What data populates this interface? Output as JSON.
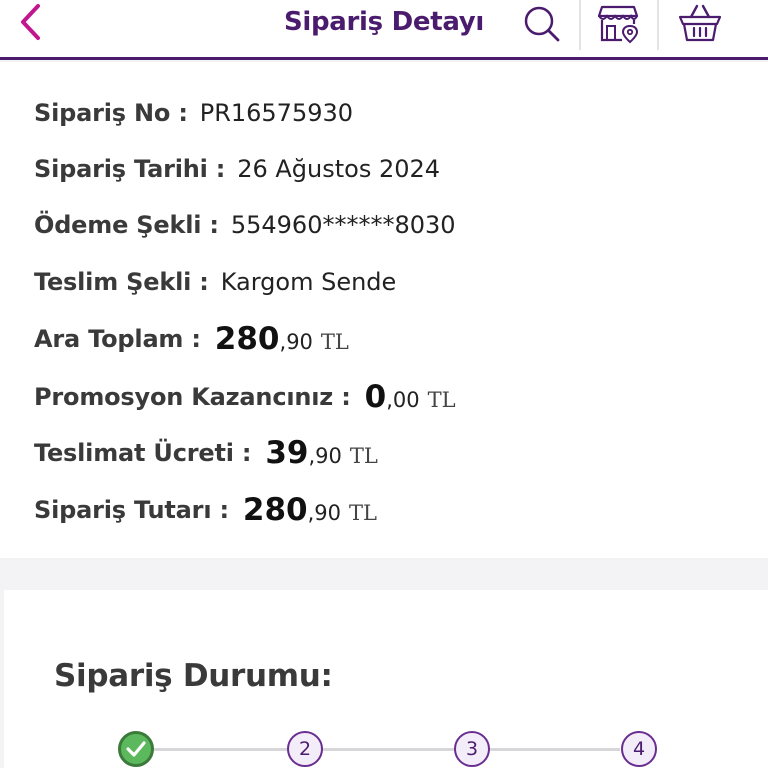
{
  "header": {
    "title": "Sipariş Detayı",
    "icons": [
      "back-chevron-icon",
      "search-icon",
      "store-location-icon",
      "basket-icon"
    ]
  },
  "order": {
    "order_no_label": "Sipariş No :",
    "order_no": "PR16575930",
    "order_date_label": "Sipariş Tarihi :",
    "order_date": "26 Ağustos 2024",
    "payment_label": "Ödeme Şekli :",
    "payment": "554960******8030",
    "delivery_label": "Teslim Şekli :",
    "delivery": "Kargom Sende",
    "subtotal_label": "Ara Toplam :",
    "subtotal_int": "280",
    "subtotal_dec": ",90",
    "promo_label": "Promosyon Kazancınız :",
    "promo_int": "0",
    "promo_dec": ",00",
    "shipping_label": "Teslimat Ücreti :",
    "shipping_int": "39",
    "shipping_dec": ",90",
    "total_label": "Sipariş Tutarı :",
    "total_int": "280",
    "total_dec": ",90",
    "currency": "TL"
  },
  "status": {
    "title": "Sipariş Durumu:",
    "steps": [
      "✓",
      "2",
      "3",
      "4"
    ],
    "completed_steps": 1
  },
  "colors": {
    "brand_purple": "#4b1c6e",
    "accent_magenta": "#c2168f",
    "success_green": "#5cb85c"
  }
}
